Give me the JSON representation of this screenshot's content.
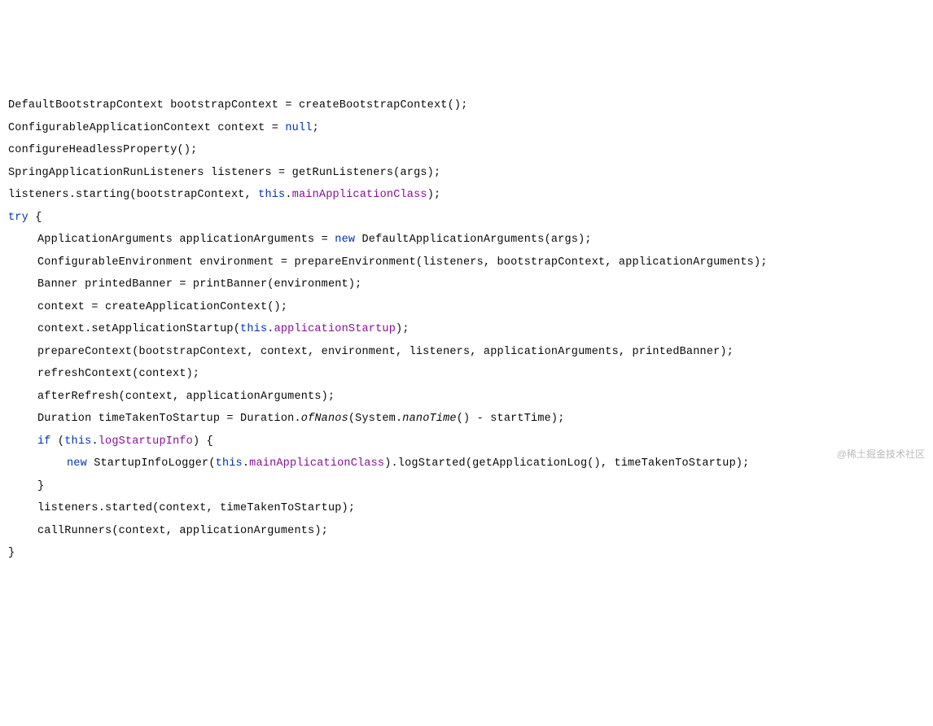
{
  "code": {
    "lines": [
      {
        "indent": 0,
        "tokens": [
          {
            "t": "DefaultBootstrapContext bootstrapContext = createBootstrapContext();",
            "c": null
          }
        ]
      },
      {
        "indent": 0,
        "tokens": [
          {
            "t": "ConfigurableApplicationContext context = ",
            "c": null
          },
          {
            "t": "null",
            "c": "keyword"
          },
          {
            "t": ";",
            "c": null
          }
        ]
      },
      {
        "indent": 0,
        "tokens": [
          {
            "t": "configureHeadlessProperty();",
            "c": null
          }
        ]
      },
      {
        "indent": 0,
        "tokens": [
          {
            "t": "SpringApplicationRunListeners listeners = getRunListeners(args);",
            "c": null
          }
        ]
      },
      {
        "indent": 0,
        "tokens": [
          {
            "t": "listeners.starting(bootstrapContext, ",
            "c": null
          },
          {
            "t": "this",
            "c": "keyword"
          },
          {
            "t": ".",
            "c": null
          },
          {
            "t": "mainApplicationClass",
            "c": "field"
          },
          {
            "t": ");",
            "c": null
          }
        ]
      },
      {
        "indent": 0,
        "tokens": [
          {
            "t": "try",
            "c": "keyword"
          },
          {
            "t": " {",
            "c": null
          }
        ]
      },
      {
        "indent": 1,
        "tokens": [
          {
            "t": "ApplicationArguments applicationArguments = ",
            "c": null
          },
          {
            "t": "new",
            "c": "keyword"
          },
          {
            "t": " DefaultApplicationArguments(args);",
            "c": null
          }
        ]
      },
      {
        "indent": 1,
        "tokens": [
          {
            "t": "ConfigurableEnvironment environment = prepareEnvironment(listeners, bootstrapContext, applicationArguments);",
            "c": null
          }
        ]
      },
      {
        "indent": 1,
        "tokens": [
          {
            "t": "Banner printedBanner = printBanner(environment);",
            "c": null
          }
        ]
      },
      {
        "indent": 1,
        "tokens": [
          {
            "t": "context = createApplicationContext();",
            "c": null
          }
        ]
      },
      {
        "indent": 1,
        "tokens": [
          {
            "t": "context.setApplicationStartup(",
            "c": null
          },
          {
            "t": "this",
            "c": "keyword"
          },
          {
            "t": ".",
            "c": null
          },
          {
            "t": "applicationStartup",
            "c": "field"
          },
          {
            "t": ");",
            "c": null
          }
        ]
      },
      {
        "indent": 1,
        "tokens": [
          {
            "t": "prepareContext(bootstrapContext, context, environment, listeners, applicationArguments, printedBanner);",
            "c": null
          }
        ]
      },
      {
        "indent": 1,
        "tokens": [
          {
            "t": "refreshContext(context);",
            "c": null
          }
        ]
      },
      {
        "indent": 1,
        "tokens": [
          {
            "t": "afterRefresh(context, applicationArguments);",
            "c": null
          }
        ]
      },
      {
        "indent": 1,
        "tokens": [
          {
            "t": "Duration timeTakenToStartup = Duration.",
            "c": null
          },
          {
            "t": "ofNanos",
            "c": "static-method"
          },
          {
            "t": "(System.",
            "c": null
          },
          {
            "t": "nanoTime",
            "c": "static-method"
          },
          {
            "t": "() - startTime);",
            "c": null
          }
        ]
      },
      {
        "indent": 1,
        "tokens": [
          {
            "t": "if",
            "c": "keyword"
          },
          {
            "t": " (",
            "c": null
          },
          {
            "t": "this",
            "c": "keyword"
          },
          {
            "t": ".",
            "c": null
          },
          {
            "t": "logStartupInfo",
            "c": "field"
          },
          {
            "t": ") {",
            "c": null
          }
        ]
      },
      {
        "indent": 2,
        "tokens": [
          {
            "t": "new",
            "c": "keyword"
          },
          {
            "t": " StartupInfoLogger(",
            "c": null
          },
          {
            "t": "this",
            "c": "keyword"
          },
          {
            "t": ".",
            "c": null
          },
          {
            "t": "mainApplicationClass",
            "c": "field"
          },
          {
            "t": ").logStarted(getApplicationLog(), timeTakenToStartup);",
            "c": null
          }
        ]
      },
      {
        "indent": 1,
        "tokens": [
          {
            "t": "}",
            "c": null
          }
        ]
      },
      {
        "indent": 1,
        "tokens": [
          {
            "t": "listeners.started(context, timeTakenToStartup);",
            "c": null
          }
        ]
      },
      {
        "indent": 1,
        "tokens": [
          {
            "t": "callRunners(context, applicationArguments);",
            "c": null
          }
        ]
      },
      {
        "indent": 0,
        "tokens": [
          {
            "t": "}",
            "c": null
          }
        ]
      }
    ]
  },
  "watermark": "@稀土掘金技术社区"
}
